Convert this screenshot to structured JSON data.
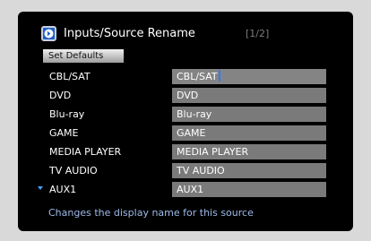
{
  "header": {
    "icon": "input-source-icon",
    "title": "Inputs/Source Rename",
    "page_indicator": "[1/2]"
  },
  "set_defaults_label": "Set Defaults",
  "sources": [
    {
      "label": "CBL/SAT",
      "name": "CBL/SAT",
      "active": true
    },
    {
      "label": "DVD",
      "name": "DVD"
    },
    {
      "label": "Blu-ray",
      "name": "Blu-ray"
    },
    {
      "label": "GAME",
      "name": "GAME"
    },
    {
      "label": "MEDIA PLAYER",
      "name": "MEDIA PLAYER"
    },
    {
      "label": "TV AUDIO",
      "name": "TV AUDIO"
    },
    {
      "label": "AUX1",
      "name": "AUX1",
      "has_scroll_indicator": true
    }
  ],
  "help_text": "Changes the display name for this source",
  "colors": {
    "screen_background": "#000000",
    "field_background": "#7a7a7a",
    "help_text": "#9eb9e9",
    "caret": "#2d7cff",
    "icon_blue": "#1f5fc7"
  }
}
